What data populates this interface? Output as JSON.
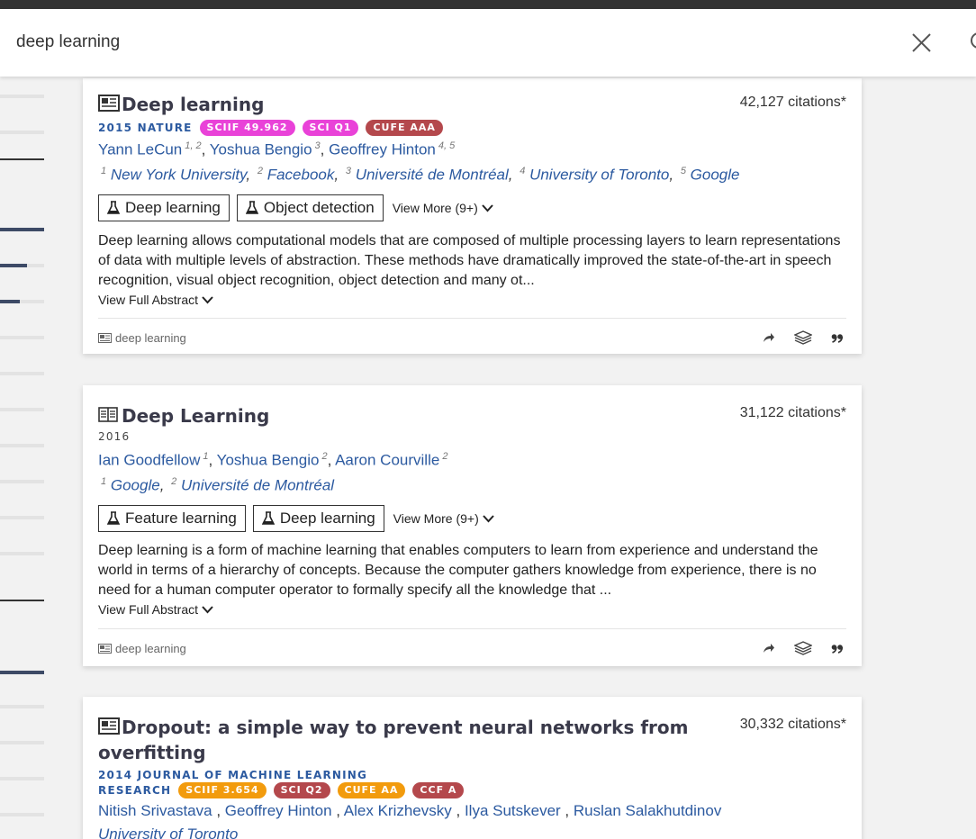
{
  "search": {
    "query": "deep learning"
  },
  "colors": {
    "accent": "#2c5aa0",
    "badge_sciif_pink": "#e942d8",
    "badge_sci_pink": "#e942d8",
    "badge_red": "#b4484c",
    "badge_orange": "#f29b0d"
  },
  "results": [
    {
      "title": "Deep learning",
      "citations": "42,127 citations*",
      "venue": "2015 NATURE",
      "badges": [
        "SCIIF 49.962",
        "SCI Q1",
        "CUFE AAA"
      ],
      "authors": [
        {
          "name": "Yann LeCun",
          "aff": "1, 2"
        },
        {
          "name": "Yoshua Bengio",
          "aff": "3"
        },
        {
          "name": "Geoffrey Hinton",
          "aff": "4, 5"
        }
      ],
      "affiliations": [
        {
          "num": "1",
          "name": "New York University"
        },
        {
          "num": "2",
          "name": "Facebook"
        },
        {
          "num": "3",
          "name": "Université de Montréal"
        },
        {
          "num": "4",
          "name": "University of Toronto"
        },
        {
          "num": "5",
          "name": "Google"
        }
      ],
      "tags": [
        "Deep learning",
        "Object detection"
      ],
      "view_more": "View More (9+)",
      "abstract": "Deep learning allows computational models that are composed of multiple processing layers to learn representations of data with multiple levels of abstraction. These methods have dramatically improved the state-of-the-art in speech recognition, visual object recognition, object detection and many ot...",
      "view_full": "View Full Abstract",
      "keyword": "deep learning"
    },
    {
      "title": "Deep Learning",
      "citations": "31,122 citations*",
      "venue": "2016",
      "badges": [],
      "authors": [
        {
          "name": "Ian Goodfellow",
          "aff": "1"
        },
        {
          "name": "Yoshua Bengio",
          "aff": "2"
        },
        {
          "name": "Aaron Courville",
          "aff": "2"
        }
      ],
      "affiliations": [
        {
          "num": "1",
          "name": "Google"
        },
        {
          "num": "2",
          "name": "Université de Montréal"
        }
      ],
      "tags": [
        "Feature learning",
        "Deep learning"
      ],
      "view_more": "View More (9+)",
      "abstract": "Deep learning is a form of machine learning that enables computers to learn from experience and understand the world in terms of a hierarchy of concepts. Because the computer gathers knowledge from experience, there is no need for a human computer operator to formally specify all the knowledge that ...",
      "view_full": "View Full Abstract",
      "keyword": "deep learning"
    },
    {
      "title_line1": "Dropout: a simple way to prevent neural networks from",
      "title_line2": "overfitting",
      "citations": "30,332 citations*",
      "venue_line1": "2014 JOURNAL OF MACHINE LEARNING",
      "venue_line2": "RESEARCH",
      "badges": [
        "SCIIF 3.654",
        "SCI Q2",
        "CUFE AA",
        "CCF A"
      ],
      "authors": [
        "Nitish Srivastava",
        "Geoffrey Hinton",
        "Alex Krizhevsky",
        "Ilya Sutskever",
        "Ruslan Salakhutdinov"
      ],
      "affiliation": "University of Toronto"
    }
  ]
}
